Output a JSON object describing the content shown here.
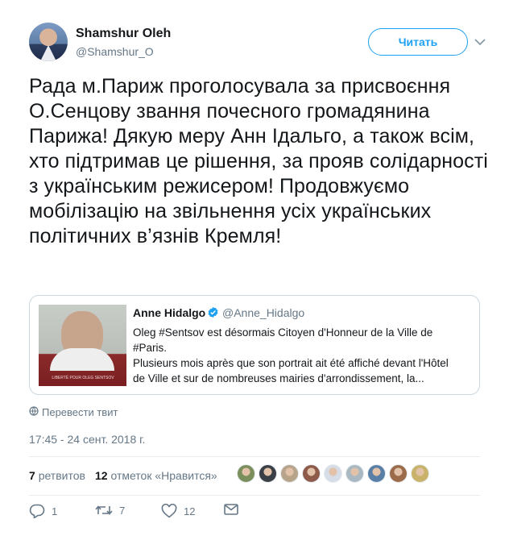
{
  "author": {
    "name": "Shamshur Oleh",
    "handle": "@Shamshur_O"
  },
  "follow_button": "Читать",
  "tweet_text": "Рада м.Париж проголосувала за присвоєння О.Сенцову звання почесного громадянина Парижа! Дякую меру Анн Ідальго, а також всім, хто підтримав це рішення, за прояв солідарності з українським режисером! Продовжуємо мобілізацію на звільнення усіх українських політичних в’язнів Кремля!",
  "quote": {
    "name": "Anne Hidalgo",
    "handle": "@Anne_Hidalgo",
    "text_line1": "Oleg #Sentsov est désormais Citoyen d'Honneur de la Ville de #Paris.",
    "text_line2": "Plusieurs mois après que son portrait ait été affiché devant l'Hôtel de Ville et sur de nombreuses mairies d'arrondissement, la...",
    "image_caption": "LIBERTÉ POUR OLEG SENTSOV"
  },
  "translate_label": "Перевести твит",
  "timestamp": "17:45 - 24 сент. 2018 г.",
  "stats": {
    "retweets_count": "7",
    "retweets_label": "ретвитов",
    "likes_count": "12",
    "likes_label": "отметок «Нравится»"
  },
  "likers": [
    {
      "color": "#7a8f5c",
      "icon": "avatar"
    },
    {
      "color": "#3b3f46",
      "icon": "avatar"
    },
    {
      "color": "#b8a48a",
      "icon": "avatar"
    },
    {
      "color": "#8e5a4a",
      "icon": "avatar"
    },
    {
      "color": "#d7dde6",
      "icon": "avatar"
    },
    {
      "color": "#aab8c2",
      "icon": "avatar"
    },
    {
      "color": "#5a7fa6",
      "icon": "avatar"
    },
    {
      "color": "#9b6b4a",
      "icon": "avatar"
    },
    {
      "color": "#c9b36a",
      "icon": "avatar"
    }
  ],
  "actions": {
    "reply_count": "1",
    "retweet_count": "7",
    "like_count": "12"
  },
  "colors": {
    "accent": "#1da1f2",
    "secondary_text": "#657786",
    "primary_text": "#14171a",
    "border": "#e6ecf0"
  }
}
